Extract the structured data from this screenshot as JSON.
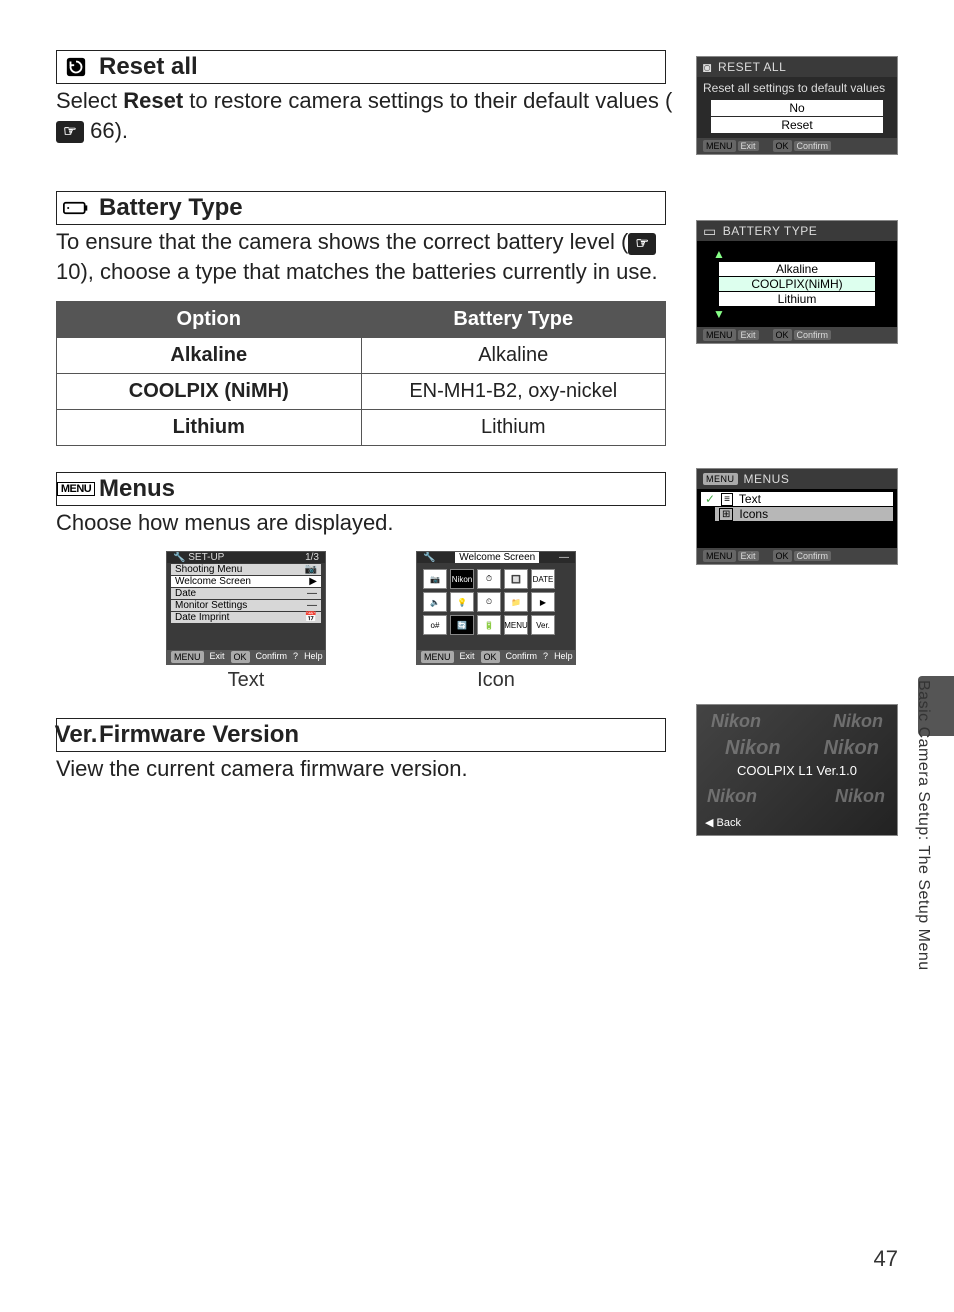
{
  "side_tab": "Basic Camera Setup: The Setup Menu",
  "page_number": "47",
  "reset_all": {
    "title": "Reset all",
    "body_pre": "Select ",
    "body_bold": "Reset",
    "body_post": " to restore camera settings to their default values (",
    "ref": "66).",
    "thumb": {
      "title": "RESET ALL",
      "prompt": "Reset all settings to default values",
      "opt_no": "No",
      "opt_reset": "Reset",
      "foot_exit": "Exit",
      "foot_confirm": "Confirm"
    }
  },
  "battery": {
    "title": "Battery Type",
    "body": "To ensure that the camera shows the correct battery level (     10), choose a type that matches the batteries currently in use.",
    "ref_num": "10",
    "table": {
      "h1": "Option",
      "h2": "Battery Type",
      "rows": [
        {
          "opt": "Alkaline",
          "type": "Alkaline"
        },
        {
          "opt": "COOLPIX (NiMH)",
          "type": "EN-MH1-B2, oxy-nickel"
        },
        {
          "opt": "Lithium",
          "type": "Lithium"
        }
      ]
    },
    "thumb": {
      "title": "BATTERY TYPE",
      "opts": [
        "Alkaline",
        "COOLPIX(NiMH)",
        "Lithium"
      ],
      "foot_exit": "Exit",
      "foot_confirm": "Confirm"
    }
  },
  "menus": {
    "title": "Menus",
    "body": "Choose how menus are displayed.",
    "fig_text": {
      "head": "SET-UP",
      "page": "1/3",
      "items": [
        "Shooting Menu",
        "Welcome Screen",
        "Date",
        "Monitor Settings",
        "Date Imprint"
      ],
      "foot": [
        "Exit",
        "Confirm",
        "Help"
      ],
      "caption": "Text"
    },
    "fig_icon": {
      "head": "Welcome Screen",
      "cells": [
        "📷",
        "Nikon",
        "⏱",
        "🔲",
        "DATE",
        "🔈",
        "💡",
        "⏲",
        "📁",
        "▶",
        "o#",
        "🔄",
        "🔋",
        "MENU",
        "Ver."
      ],
      "foot": [
        "Exit",
        "Confirm",
        "Help"
      ],
      "caption": "Icon"
    },
    "thumb": {
      "title": "MENUS",
      "opt_text": "Text",
      "opt_icons": "Icons",
      "foot_exit": "Exit",
      "foot_confirm": "Confirm"
    }
  },
  "firmware": {
    "title": "Firmware Version",
    "body": "View the current camera firmware version.",
    "thumb": {
      "brand": "Nikon",
      "version": "COOLPIX L1 Ver.1.0",
      "back": "Back"
    }
  }
}
